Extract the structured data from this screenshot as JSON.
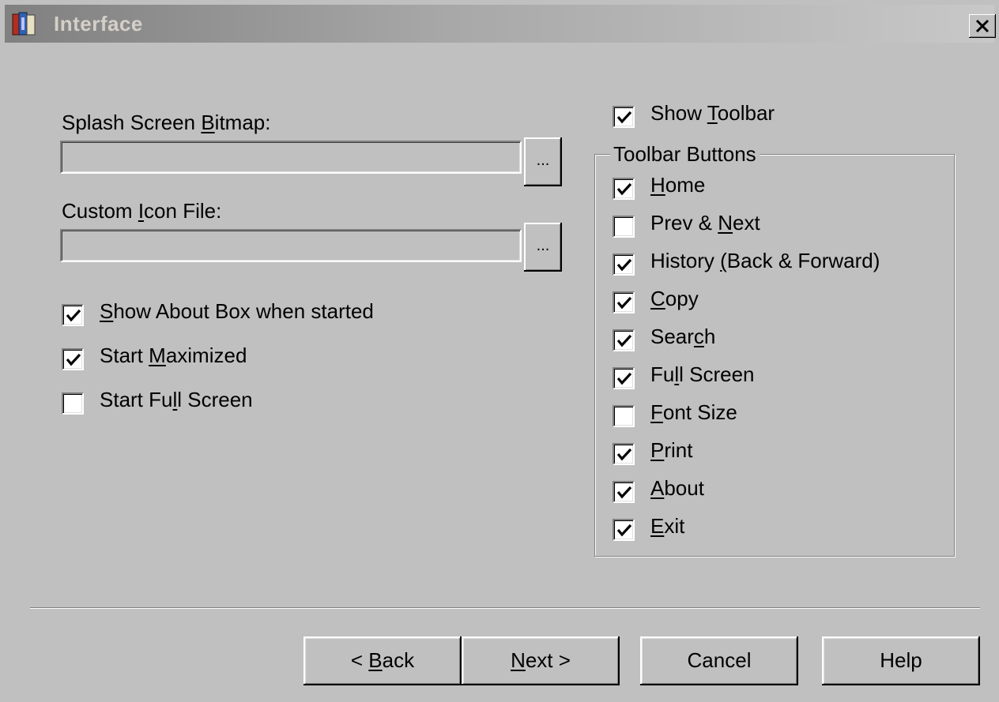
{
  "window": {
    "title": "Interface",
    "close_label": "×"
  },
  "left": {
    "splash_label_pre": "Splash Screen ",
    "splash_label_acc": "B",
    "splash_label_post": "itmap:",
    "splash_value": "",
    "splash_browse": "...",
    "icon_label_pre": "Custom ",
    "icon_label_acc": "I",
    "icon_label_post": "con File:",
    "icon_value": "",
    "icon_browse": "...",
    "options": [
      {
        "pre": "",
        "acc": "S",
        "post": "how About Box when started",
        "checked": true
      },
      {
        "pre": "Start ",
        "acc": "M",
        "post": "aximized",
        "checked": true
      },
      {
        "pre": "Start Fu",
        "acc": "l",
        "post": "l Screen",
        "checked": false
      }
    ]
  },
  "right": {
    "show_toolbar": {
      "pre": "Show ",
      "acc": "T",
      "post": "oolbar",
      "checked": true
    },
    "group_title": "Toolbar Buttons",
    "buttons": [
      {
        "pre": "",
        "acc": "H",
        "post": "ome",
        "checked": true
      },
      {
        "pre": "Prev & ",
        "acc": "N",
        "post": "ext",
        "checked": false
      },
      {
        "pre": "History ",
        "acc": "(",
        "post": "Back & Forward)",
        "checked": true
      },
      {
        "pre": "",
        "acc": "C",
        "post": "opy",
        "checked": true
      },
      {
        "pre": "Sear",
        "acc": "c",
        "post": "h",
        "checked": true
      },
      {
        "pre": "Fu",
        "acc": "l",
        "post": "l Screen",
        "checked": true
      },
      {
        "pre": "",
        "acc": "F",
        "post": "ont Size",
        "checked": false
      },
      {
        "pre": "",
        "acc": "P",
        "post": "rint",
        "checked": true
      },
      {
        "pre": "",
        "acc": "A",
        "post": "bout",
        "checked": true
      },
      {
        "pre": "",
        "acc": "E",
        "post": "xit",
        "checked": true
      }
    ]
  },
  "footer": {
    "back": {
      "pre": "< ",
      "acc": "B",
      "post": "ack"
    },
    "next": {
      "pre": "",
      "acc": "N",
      "post": "ext >"
    },
    "cancel": "Cancel",
    "help": "Help"
  }
}
